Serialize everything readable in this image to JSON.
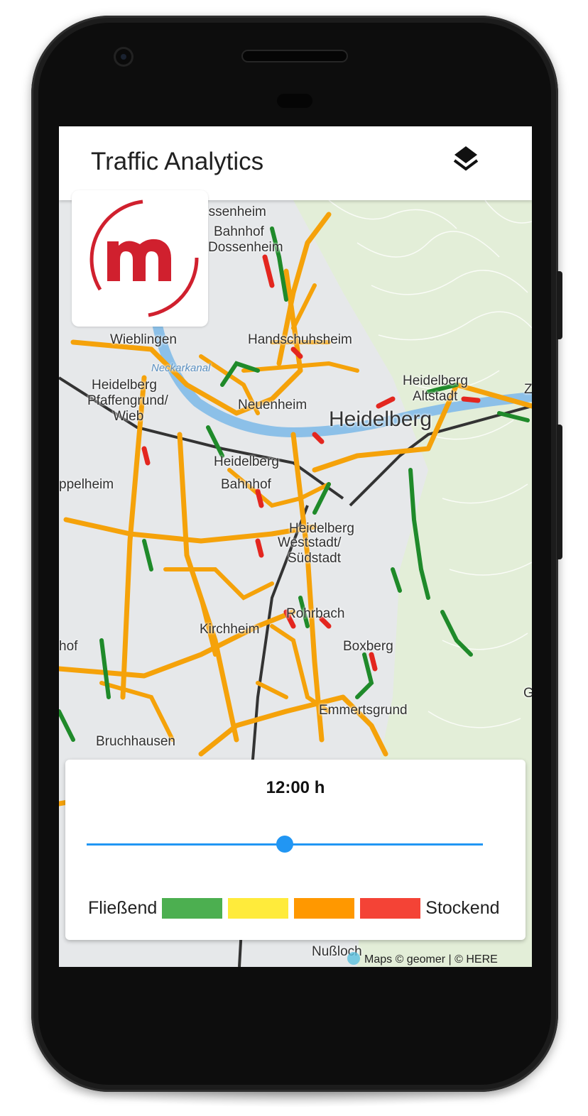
{
  "app": {
    "title": "Traffic Analytics",
    "layers_icon": "layers-icon",
    "logo_icon": "m-logo-icon"
  },
  "map": {
    "labels": {
      "dossenheim": "ossenheim",
      "bahnhof": "Bahnhof",
      "bahnhof2": "Dossenheim",
      "wieblingen": "Wieblingen",
      "handschuhsheim": "Handschuhsheim",
      "neckarkanal": "Neckarkanal",
      "heidelberg_altstadt1": "Heidelberg",
      "heidelberg_altstadt2": "Altstadt",
      "heidelberg": "Heidelberg",
      "neuenheim": "Neuenheim",
      "pfaffengrund1": "Heidelberg",
      "pfaffengrund2": "Pfaffengrund/",
      "pfaffengrund3": "Wieb",
      "eppelheim": "ppelheim",
      "hauptbahnhof1": "Heidelberg",
      "hauptbahnhof2": "Bahnhof",
      "weststadt1": "Heidelberg",
      "weststadt2": "Weststadt/",
      "weststadt3": "Südstadt",
      "rohrbach": "Rohrbach",
      "kirchheim": "Kirchheim",
      "boxberg": "Boxberg",
      "hof": "hof",
      "emmertsgrund": "Emmertsgrund",
      "bruchhausen": "Bruchhausen",
      "nussloch": "Nußloch",
      "g": "G",
      "z": "Z"
    },
    "attribution": "Maps © geomer | © HERE"
  },
  "controls": {
    "time_label": "12:00 h",
    "slider_value": 0.5,
    "legend_left": "Fließend",
    "legend_right": "Stockend",
    "legend_colors": [
      "#4caf50",
      "#ffeb3b",
      "#ff9800",
      "#f44336"
    ]
  }
}
